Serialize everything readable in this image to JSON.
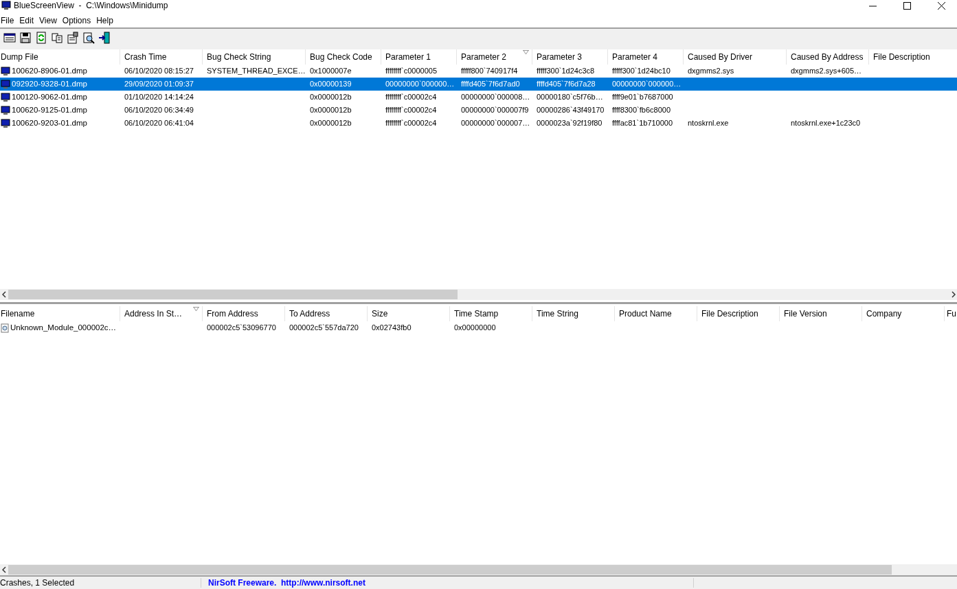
{
  "window": {
    "title": "BlueScreenView  -  C:\\Windows\\Minidump"
  },
  "menu": [
    "File",
    "Edit",
    "View",
    "Options",
    "Help"
  ],
  "crashes": {
    "columns": [
      {
        "label": "Dump File",
        "sorted": false
      },
      {
        "label": "Crash Time",
        "sorted": false
      },
      {
        "label": "Bug Check String",
        "sorted": false
      },
      {
        "label": "Bug Check Code",
        "sorted": false
      },
      {
        "label": "Parameter 1",
        "sorted": false
      },
      {
        "label": "Parameter 2",
        "sorted": true
      },
      {
        "label": "Parameter 3",
        "sorted": false
      },
      {
        "label": "Parameter 4",
        "sorted": false
      },
      {
        "label": "Caused By Driver",
        "sorted": false
      },
      {
        "label": "Caused By Address",
        "sorted": false
      },
      {
        "label": "File Description",
        "sorted": false
      }
    ],
    "rows": [
      {
        "selected": false,
        "cells": [
          "100620-8906-01.dmp",
          "06/10/2020 08:15:27",
          "SYSTEM_THREAD_EXCE…",
          "0x1000007e",
          "ffffffff`c0000005",
          "fffff800`740917f4",
          "fffff300`1d24c3c8",
          "fffff300`1d24bc10",
          "dxgmms2.sys",
          "dxgmms2.sys+605…",
          ""
        ]
      },
      {
        "selected": true,
        "cells": [
          "092920-9328-01.dmp",
          "29/09/2020 01:09:37",
          "",
          "0x00000139",
          "00000000`000000…",
          "ffffd405`7f6d7ad0",
          "ffffd405`7f6d7a28",
          "00000000`000000…",
          "",
          "",
          ""
        ]
      },
      {
        "selected": false,
        "cells": [
          "100120-9062-01.dmp",
          "01/10/2020 14:14:24",
          "",
          "0x0000012b",
          "ffffffff`c00002c4",
          "00000000`000008…",
          "00000180`c5f76b…",
          "ffff9e01`b7687000",
          "",
          "",
          ""
        ]
      },
      {
        "selected": false,
        "cells": [
          "100620-9125-01.dmp",
          "06/10/2020 06:34:49",
          "",
          "0x0000012b",
          "ffffffff`c00002c4",
          "00000000`000007f9",
          "00000286`43f49170",
          "ffff8300`fb6c8000",
          "",
          "",
          ""
        ]
      },
      {
        "selected": false,
        "cells": [
          "100620-9203-01.dmp",
          "06/10/2020 06:41:04",
          "",
          "0x0000012b",
          "ffffffff`c00002c4",
          "00000000`000007…",
          "0000023a`92f19f80",
          "ffffac81`1b710000",
          "ntoskrnl.exe",
          "ntoskrnl.exe+1c23c0",
          ""
        ]
      }
    ]
  },
  "modules": {
    "columns": [
      {
        "label": "Filename",
        "sorted": false
      },
      {
        "label": "Address In St…",
        "sorted": true
      },
      {
        "label": "From Address",
        "sorted": false
      },
      {
        "label": "To Address",
        "sorted": false
      },
      {
        "label": "Size",
        "sorted": false
      },
      {
        "label": "Time Stamp",
        "sorted": false
      },
      {
        "label": "Time String",
        "sorted": false
      },
      {
        "label": "Product Name",
        "sorted": false
      },
      {
        "label": "File Description",
        "sorted": false
      },
      {
        "label": "File Version",
        "sorted": false
      },
      {
        "label": "Company",
        "sorted": false
      },
      {
        "label": "Fu",
        "sorted": false
      }
    ],
    "rows": [
      {
        "selected": false,
        "cells": [
          "Unknown_Module_000002c…",
          "",
          "000002c5`53096770",
          "000002c5`557da720",
          "0x02743fb0",
          "0x00000000",
          "",
          "",
          "",
          "",
          "",
          ""
        ]
      }
    ]
  },
  "status_bar": {
    "count": "Crashes, 1 Selected",
    "link": "NirSoft Freeware.  http://www.nirsoft.net"
  }
}
